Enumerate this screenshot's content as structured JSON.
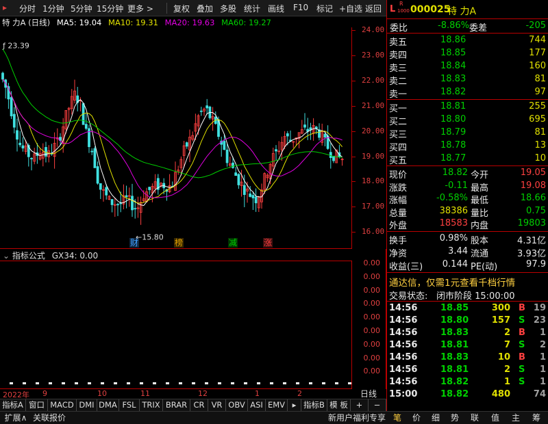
{
  "toolbar": {
    "items": [
      "分时",
      "1分钟",
      "5分钟",
      "15分钟",
      "更多 >",
      "复权",
      "叠加",
      "多股",
      "统计",
      "画线",
      "F10",
      "标记",
      "+自选",
      "返回"
    ]
  },
  "chart": {
    "title": "特 力A (日线)",
    "ma5": "MA5: 19.04",
    "ma10": "MA10: 19.31",
    "ma20": "MA20: 19.63",
    "ma60": "MA60: 19.27",
    "high_label": "23.39",
    "low_label": "15.80",
    "markers": [
      "财",
      "榜",
      "减",
      "涨"
    ],
    "price_axis": [
      "24.00",
      "23.00",
      "22.00",
      "21.00",
      "20.00",
      "19.00",
      "18.00",
      "17.00",
      "16.00"
    ]
  },
  "indicator": {
    "header_name": "指标公式",
    "header_value": "GX34: 0.00",
    "axis": [
      "0.00",
      "0.00",
      "0.00",
      "0.00",
      "0.00",
      "0.00",
      "0.00",
      "0.00",
      "0.00"
    ]
  },
  "date_axis": [
    "2022年",
    "9",
    "10",
    "11",
    "12",
    "1",
    "2"
  ],
  "date_axis_right": "日线",
  "indicator_tabs": [
    "指标A",
    "窗口",
    "MACD",
    "DMI",
    "DMA",
    "FSL",
    "TRIX",
    "BRAR",
    "CR",
    "VR",
    "OBV",
    "ASI",
    "EMV",
    "指标B",
    "模 板",
    "+",
    "−"
  ],
  "bottom_bar": {
    "left": [
      "扩展∧",
      "关联报价"
    ],
    "promo": "新用户福利专享",
    "right_tabs": [
      "笔",
      "价",
      "细",
      "势",
      "联",
      "值",
      "主",
      "筹"
    ]
  },
  "quote": {
    "badge_l": "L",
    "badge_r": "R",
    "badge_num": "1000",
    "code": "000025",
    "name": "特 力A",
    "webi_label": "委比",
    "webi_value": "-8.86%",
    "weicha_label": "委差",
    "weicha_value": "-205",
    "asks": [
      {
        "label": "卖五",
        "price": "18.86",
        "vol": "744"
      },
      {
        "label": "卖四",
        "price": "18.85",
        "vol": "177"
      },
      {
        "label": "卖三",
        "price": "18.84",
        "vol": "160"
      },
      {
        "label": "卖二",
        "price": "18.83",
        "vol": "81"
      },
      {
        "label": "卖一",
        "price": "18.82",
        "vol": "97"
      }
    ],
    "bids": [
      {
        "label": "买一",
        "price": "18.81",
        "vol": "255"
      },
      {
        "label": "买二",
        "price": "18.80",
        "vol": "695"
      },
      {
        "label": "买三",
        "price": "18.79",
        "vol": "81"
      },
      {
        "label": "买四",
        "price": "18.78",
        "vol": "13"
      },
      {
        "label": "买五",
        "price": "18.77",
        "vol": "10"
      }
    ],
    "stats": [
      {
        "l1": "现价",
        "v1": "18.82",
        "c1": "green",
        "l2": "今开",
        "v2": "19.05",
        "c2": "red"
      },
      {
        "l1": "涨跌",
        "v1": "-0.11",
        "c1": "green",
        "l2": "最高",
        "v2": "19.08",
        "c2": "red"
      },
      {
        "l1": "涨幅",
        "v1": "-0.58%",
        "c1": "green",
        "l2": "最低",
        "v2": "18.66",
        "c2": "green"
      },
      {
        "l1": "总量",
        "v1": "38386",
        "c1": "yellow",
        "l2": "量比",
        "v2": "0.75",
        "c2": "green"
      },
      {
        "l1": "外盘",
        "v1": "18583",
        "c1": "red",
        "l2": "内盘",
        "v2": "19803",
        "c2": "green"
      }
    ],
    "stats2": [
      {
        "l1": "换手",
        "v1": "0.98%",
        "l2": "股本",
        "v2": "4.31亿"
      },
      {
        "l1": "净资",
        "v1": "3.44",
        "l2": "流通",
        "v2": "3.93亿"
      },
      {
        "l1": "收益(三)",
        "v1": "0.144",
        "l2": "PE(动)",
        "v2": "97.9"
      }
    ],
    "promo": "通达信，仅需1元查看千档行情",
    "trade_status_label": "交易状态:",
    "trade_status_value": "闭市阶段 15:00:00",
    "ticks": [
      {
        "time": "14:56",
        "price": "18.85",
        "vol": "300",
        "side": "B",
        "n": "19"
      },
      {
        "time": "14:56",
        "price": "18.80",
        "vol": "157",
        "side": "S",
        "n": "23"
      },
      {
        "time": "14:56",
        "price": "18.83",
        "vol": "2",
        "side": "B",
        "n": "1"
      },
      {
        "time": "14:56",
        "price": "18.81",
        "vol": "7",
        "side": "S",
        "n": "2"
      },
      {
        "time": "14:56",
        "price": "18.83",
        "vol": "10",
        "side": "B",
        "n": "1"
      },
      {
        "time": "14:56",
        "price": "18.81",
        "vol": "2",
        "side": "S",
        "n": "1"
      },
      {
        "time": "14:56",
        "price": "18.82",
        "vol": "1",
        "side": "S",
        "n": "1"
      },
      {
        "time": "15:00",
        "price": "18.82",
        "vol": "480",
        "side": "",
        "n": "74"
      }
    ]
  },
  "colors": {
    "up": "#ff4040",
    "down": "#00d000",
    "ma5": "#ffffff",
    "ma10": "#e0e000",
    "ma20": "#e000e0",
    "ma60": "#00d000",
    "border": "#b00000"
  }
}
